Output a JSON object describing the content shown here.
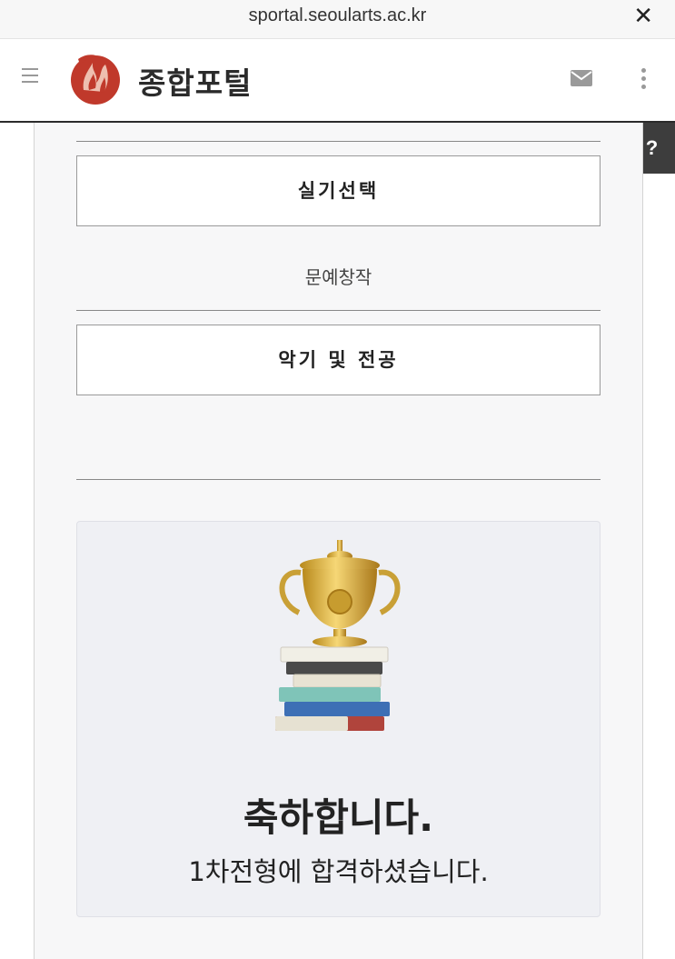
{
  "browser": {
    "url": "sportal.seoularts.ac.kr",
    "close_glyph": "✕"
  },
  "appbar": {
    "title": "종합포털",
    "icons": [
      "menu-icon",
      "university-logo",
      "mail-icon",
      "more-vertical-icon"
    ]
  },
  "help_tab": {
    "label": "?"
  },
  "form": {
    "practical_button_label": "실기선택",
    "practical_choice": "문예창작",
    "instrument_button_label": "악기 및 전공"
  },
  "result": {
    "headline": "축하합니다.",
    "message": "1차전형에 합격하셨습니다."
  },
  "colors": {
    "brand_red": "#c0392b",
    "help_tab_bg": "#3d3d3d",
    "card_bg": "#eff0f4"
  }
}
